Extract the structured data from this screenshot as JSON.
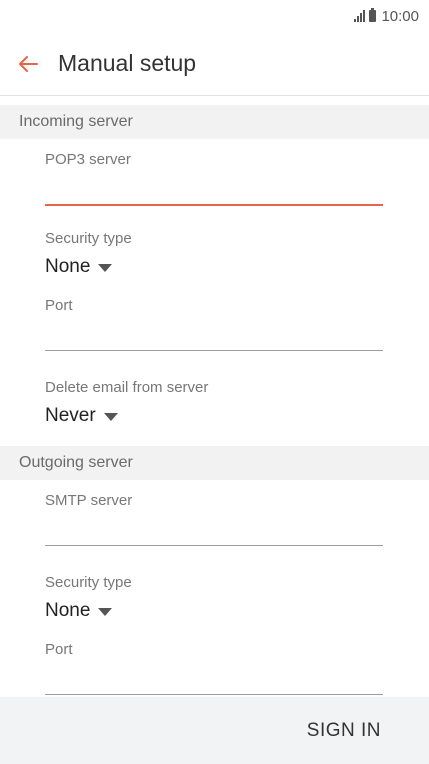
{
  "status_bar": {
    "time": "10:00",
    "icons": [
      "signal-icon",
      "battery-icon"
    ]
  },
  "app_bar": {
    "title": "Manual setup",
    "back_icon": "back-arrow-icon",
    "accent_color": "#e8634a"
  },
  "incoming": {
    "header": "Incoming server",
    "server_label": "POP3 server",
    "server_value": "",
    "security_label": "Security type",
    "security_value": "None",
    "port_label": "Port",
    "port_value": "",
    "delete_label": "Delete email from server",
    "delete_value": "Never"
  },
  "outgoing": {
    "header": "Outgoing server",
    "server_label": "SMTP server",
    "server_value": "",
    "security_label": "Security type",
    "security_value": "None",
    "port_label": "Port"
  },
  "footer": {
    "sign_in_label": "SIGN IN"
  }
}
